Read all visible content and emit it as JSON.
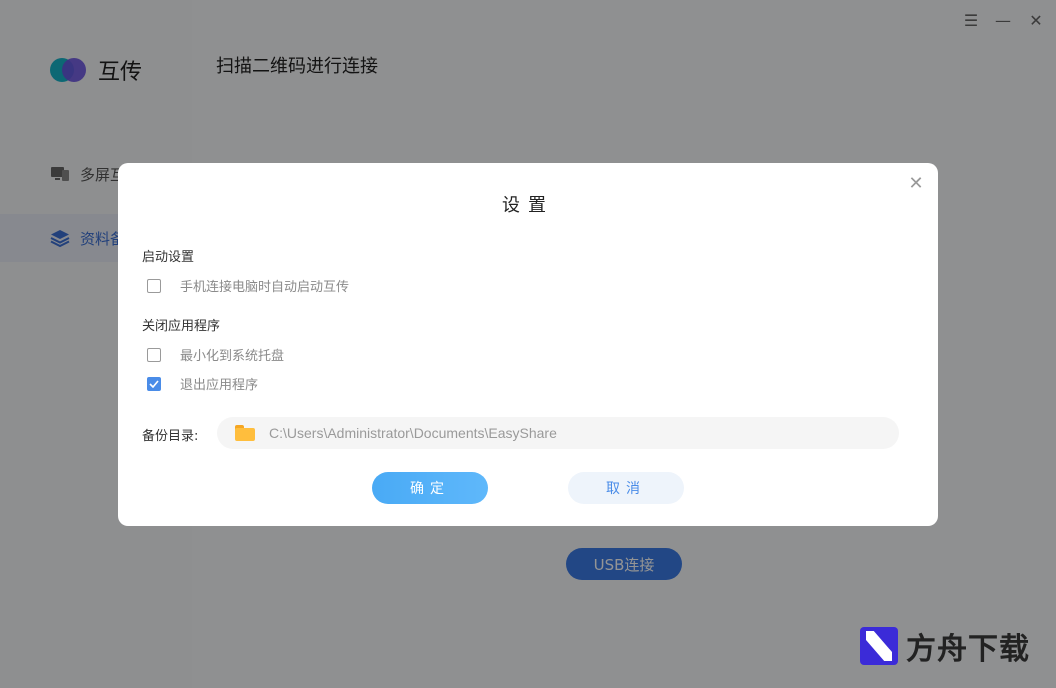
{
  "app": {
    "name": "互传",
    "header_title": "扫描二维码进行连接",
    "usb_button": "USB连接"
  },
  "window_controls": {
    "menu": "☰",
    "minimize": "—",
    "close": "✕"
  },
  "sidebar": {
    "items": [
      {
        "label": "多屏互",
        "icon": "monitor-icon",
        "active": false
      },
      {
        "label": "资料备",
        "icon": "layers-icon",
        "active": true
      }
    ]
  },
  "dialog": {
    "title": "设置",
    "close_glyph": "✕",
    "startup_section": "启动设置",
    "startup_option": {
      "label": "手机连接电脑时自动启动互传",
      "checked": false
    },
    "close_section": "关闭应用程序",
    "close_options": [
      {
        "label": "最小化到系统托盘",
        "checked": false
      },
      {
        "label": "退出应用程序",
        "checked": true
      }
    ],
    "backup_label": "备份目录:",
    "backup_path": "C:\\Users\\Administrator\\Documents\\EasyShare",
    "ok_label": "确定",
    "cancel_label": "取消"
  },
  "watermark": {
    "text": "方舟下载"
  },
  "colors": {
    "accent": "#4a8ce8",
    "ok_button": "#49aaf5",
    "usb_button": "#3b7be6",
    "logo_teal": "#17b3c9",
    "logo_purple": "#6a52e0"
  }
}
